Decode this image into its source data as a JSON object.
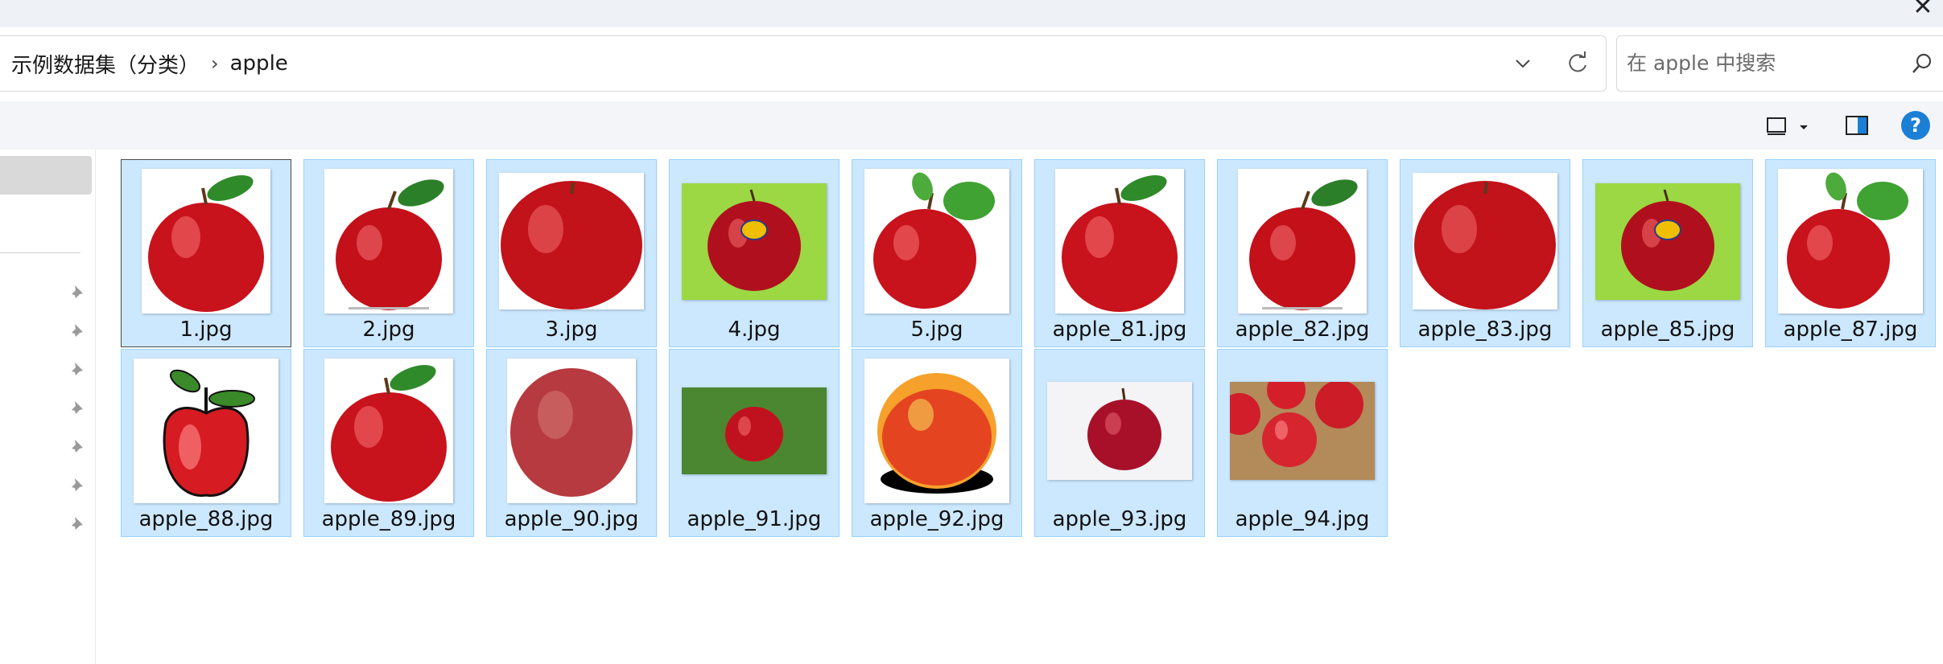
{
  "window": {
    "close_icon": "close-icon"
  },
  "address": {
    "breadcrumbs": [
      "示例数据集（分类）",
      "apple"
    ],
    "separator": "›"
  },
  "search": {
    "placeholder": "在 apple 中搜索"
  },
  "toolbar": {
    "help_label": "?"
  },
  "colors": {
    "selection_bg": "#cce8ff",
    "selection_border": "#99d1ff",
    "help_blue": "#1b7fd6"
  },
  "files": [
    {
      "name": "1.jpg",
      "thumb": "apple-leaf"
    },
    {
      "name": "2.jpg",
      "thumb": "apple-leaf-watermark"
    },
    {
      "name": "3.jpg",
      "thumb": "apple-large"
    },
    {
      "name": "4.jpg",
      "thumb": "apple-sticker-green-bg"
    },
    {
      "name": "5.jpg",
      "thumb": "apple-two-leaves"
    },
    {
      "name": "apple_81.jpg",
      "thumb": "apple-leaf"
    },
    {
      "name": "apple_82.jpg",
      "thumb": "apple-leaf-watermark"
    },
    {
      "name": "apple_83.jpg",
      "thumb": "apple-large"
    },
    {
      "name": "apple_85.jpg",
      "thumb": "apple-sticker-green-bg"
    },
    {
      "name": "apple_87.jpg",
      "thumb": "apple-two-leaves"
    },
    {
      "name": "apple_88.jpg",
      "thumb": "apple-cartoon"
    },
    {
      "name": "apple_89.jpg",
      "thumb": "apple-leaf"
    },
    {
      "name": "apple_90.jpg",
      "thumb": "apple-plain"
    },
    {
      "name": "apple_91.jpg",
      "thumb": "apple-on-grass"
    },
    {
      "name": "apple_92.jpg",
      "thumb": "apple-yellow-red"
    },
    {
      "name": "apple_93.jpg",
      "thumb": "apple-white-bg"
    },
    {
      "name": "apple_94.jpg",
      "thumb": "apples-on-wood"
    }
  ]
}
